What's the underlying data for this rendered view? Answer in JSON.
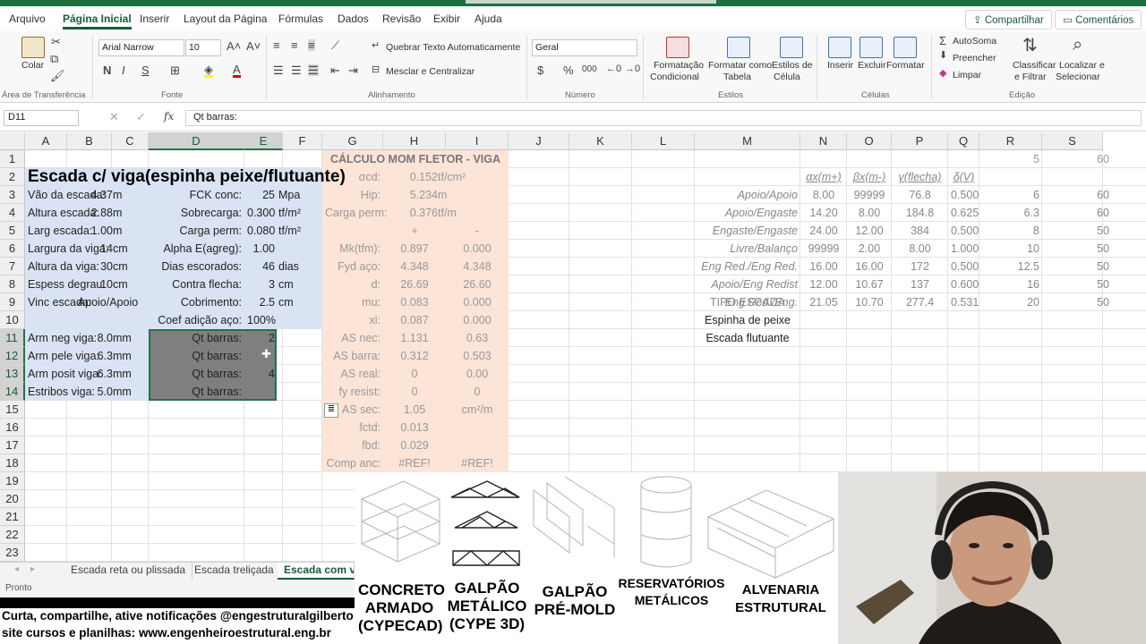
{
  "menu": {
    "tabs": [
      "Arquivo",
      "Página Inicial",
      "Inserir",
      "Layout da Página",
      "Fórmulas",
      "Dados",
      "Revisão",
      "Exibir",
      "Ajuda"
    ],
    "share": "Compartilhar",
    "comments": "Comentários"
  },
  "ribbon": {
    "paste": "Colar",
    "clipboard_group": "Área de Transferência",
    "font_name": "Arial Narrow",
    "font_size": "10",
    "font_group": "Fonte",
    "wrap_text": "Quebrar Texto Automaticamente",
    "merge_center": "Mesclar e Centralizar",
    "alignment_group": "Alinhamento",
    "number_format": "Geral",
    "number_group": "Número",
    "cond_format": [
      "Formatação",
      "Condicional"
    ],
    "format_table": [
      "Formatar como",
      "Tabela"
    ],
    "cell_styles": [
      "Estilos de",
      "Célula"
    ],
    "styles_group": "Estilos",
    "insert": "Inserir",
    "delete": "Excluir",
    "format": "Formatar",
    "cells_group": "Células",
    "autosum": "AutoSoma",
    "fill": "Preencher",
    "clear": "Limpar",
    "sort_filter": [
      "Classificar",
      "e Filtrar"
    ],
    "find_select": [
      "Localizar e",
      "Selecionar"
    ],
    "editing_group": "Edição"
  },
  "formula_bar": {
    "name_box": "D11",
    "formula": "Qt barras:"
  },
  "columns": [
    "A",
    "B",
    "C",
    "D",
    "E",
    "F",
    "G",
    "H",
    "I",
    "J",
    "K",
    "L",
    "M",
    "N",
    "O",
    "P",
    "Q",
    "R",
    "S"
  ],
  "rows": [
    "1",
    "2",
    "3",
    "4",
    "5",
    "6",
    "7",
    "8",
    "9",
    "10",
    "11",
    "12",
    "13",
    "14",
    "15",
    "16",
    "17",
    "18",
    "19",
    "20",
    "21",
    "22",
    "23"
  ],
  "sheet": {
    "title": "Escada c/ viga(espinha peixe/flutuante)",
    "left": [
      [
        "Vão da escada:",
        "4.37",
        "m"
      ],
      [
        "Altura escada:",
        "2.88",
        "m"
      ],
      [
        "Larg escada:",
        "1.00",
        "m"
      ],
      [
        "Largura da viga:",
        "14",
        "cm"
      ],
      [
        "Altura da viga:",
        "30",
        "cm"
      ],
      [
        "Espess degrau:",
        "10",
        "cm"
      ],
      [
        "Vinc escada:",
        "Apoio/Apoio",
        ""
      ]
    ],
    "mid": [
      [
        "FCK conc:",
        "25",
        "Mpa"
      ],
      [
        "Sobrecarga:",
        "0.300",
        "tf/m²"
      ],
      [
        "Carga perm:",
        "0.080",
        "tf/m²"
      ],
      [
        "Alpha E(agreg):",
        "1.00",
        ""
      ],
      [
        "Dias escorados:",
        "46",
        "dias"
      ],
      [
        "Contra flecha:",
        "3",
        "cm"
      ],
      [
        "Cobrimento:",
        "2.5",
        "cm"
      ],
      [
        "Coef adição aço:",
        "100%",
        ""
      ]
    ],
    "arm": [
      [
        "Arm neg viga:",
        "8.0",
        "mm",
        "Qt barras:",
        "2"
      ],
      [
        "Arm pele viga:",
        "6.3",
        "mm",
        "Qt barras:",
        ""
      ],
      [
        "Arm posit viga:",
        "6.3",
        "mm",
        "Qt barras:",
        "4"
      ],
      [
        "Estribos viga:",
        "5.0",
        "mm",
        "Qt barras:",
        ""
      ]
    ],
    "calc_title": "CÁLCULO MOM FLETOR - VIGA",
    "calc_top": [
      [
        "σcd:",
        "0.152",
        "tf/cm²"
      ],
      [
        "Hip:",
        "5.234",
        "m"
      ],
      [
        "Carga perm:",
        "0.376",
        "tf/m"
      ]
    ],
    "calc_plus": "+",
    "calc_minus": "-",
    "calc": [
      [
        "Mk(tfm):",
        "0.897",
        "0.000"
      ],
      [
        "Fyd aço:",
        "4.348",
        "4.348"
      ],
      [
        "d:",
        "26.69",
        "26.60"
      ],
      [
        "mu:",
        "0.083",
        "0.000"
      ],
      [
        "xi:",
        "0.087",
        "0.000"
      ],
      [
        "AS nec:",
        "1.131",
        "0.63"
      ],
      [
        "AS barra:",
        "0.312",
        "0.503"
      ],
      [
        "AS real:",
        "0",
        "0.00"
      ],
      [
        "fy resist:",
        "0",
        "0"
      ],
      [
        "AS sec:",
        "1.05",
        "cm²/m"
      ],
      [
        "fctd:",
        "0.013",
        ""
      ],
      [
        "fbd:",
        "0.029",
        ""
      ],
      [
        "Comp anc:",
        "#REF!",
        "#REF!"
      ]
    ],
    "table_head": [
      "αx(m+)",
      "βx(m-)",
      "γ(flecha)",
      "δ(V)"
    ],
    "table": [
      [
        "Apoio/Apoio",
        "8.00",
        "99999",
        "76.8",
        "0.500",
        "6",
        "60"
      ],
      [
        "Apoio/Engaste",
        "14.20",
        "8.00",
        "184.8",
        "0.625",
        "6.3",
        "60"
      ],
      [
        "Engaste/Engaste",
        "24.00",
        "12.00",
        "384",
        "0.500",
        "8",
        "50"
      ],
      [
        "Livre/Balanço",
        "99999",
        "2.00",
        "8.00",
        "1.000",
        "10",
        "50"
      ],
      [
        "Eng Red./Eng Red.",
        "16.00",
        "16.00",
        "172",
        "0.500",
        "12.5",
        "50"
      ],
      [
        "Apoio/Eng Redist",
        "12.00",
        "10.67",
        "137",
        "0.600",
        "16",
        "50"
      ],
      [
        "Eng Red./Eng.",
        "21.05",
        "10.70",
        "277.4",
        "0.531",
        "20",
        "50"
      ]
    ],
    "r1": [
      "5",
      "60"
    ],
    "tipo_title": "TIPO ESCADA",
    "tipo": [
      "Espinha de peixe",
      "Escada flutuante"
    ]
  },
  "sheet_tabs": [
    "Escada reta ou plissada",
    "Escada treliçada",
    "Escada com viga"
  ],
  "status": "Pronto",
  "banner": [
    "Curta, compartilhe, ative notificações @engestruturalgilberto",
    "site cursos e planilhas: www.engenheiroestrutural.eng.br"
  ],
  "promo": [
    [
      "CONCRETO",
      "ARMADO",
      "(CYPECAD)"
    ],
    [
      "GALPÃO",
      "METÁLICO",
      "(CYPE 3D)"
    ],
    [
      "GALPÃO",
      "PRÉ-MOLD"
    ],
    [
      "RESERVATÓRIOS",
      "METÁLICOS"
    ],
    [
      "ALVENARIA",
      "ESTRUTURAL"
    ]
  ]
}
